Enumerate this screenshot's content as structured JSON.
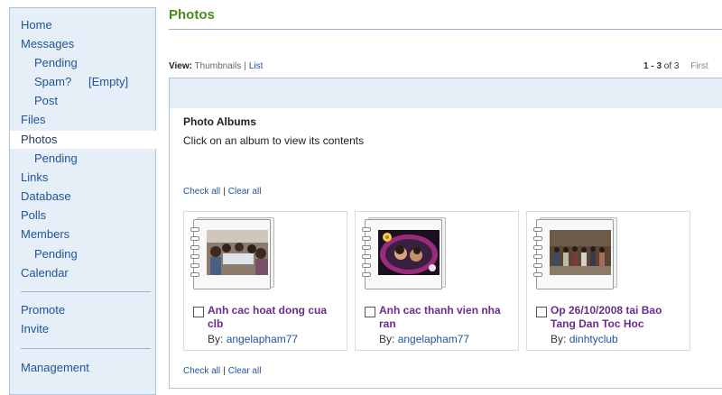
{
  "sidebar": {
    "items": [
      {
        "label": "Home"
      },
      {
        "label": "Messages"
      },
      {
        "label": "Pending"
      },
      {
        "label": "Spam?",
        "badge": "[Empty]"
      },
      {
        "label": "Post"
      },
      {
        "label": "Files"
      },
      {
        "label": "Photos"
      },
      {
        "label": "Pending"
      },
      {
        "label": "Links"
      },
      {
        "label": "Database"
      },
      {
        "label": "Polls"
      },
      {
        "label": "Members"
      },
      {
        "label": "Pending"
      },
      {
        "label": "Calendar"
      },
      {
        "label": "Promote"
      },
      {
        "label": "Invite"
      },
      {
        "label": "Management"
      }
    ]
  },
  "page": {
    "title": "Photos"
  },
  "view": {
    "label": "View:",
    "thumbnails": "Thumbnails",
    "separator": "|",
    "list": "List"
  },
  "pager": {
    "range": "1 - 3",
    "of": "of 3",
    "first": "First"
  },
  "albums": {
    "title": "Photo Albums",
    "description": "Click on an album to view its contents",
    "check_all": "Check all",
    "separator": "|",
    "clear_all": "Clear all",
    "by_label": "By:",
    "items": [
      {
        "title": "Anh cac hoat dong cua clb",
        "author": "angelapham77"
      },
      {
        "title": "Anh cac thanh vien nha ran",
        "author": "angelapham77"
      },
      {
        "title": "Op 26/10/2008 tai Bao Tang Dan Toc Hoc",
        "author": "dinhtyclub"
      }
    ]
  },
  "colors": {
    "sidebar_bg": "#e6eef7",
    "link": "#1f5499",
    "title_green": "#4b8a1a",
    "album_title": "#6b2c8c"
  }
}
